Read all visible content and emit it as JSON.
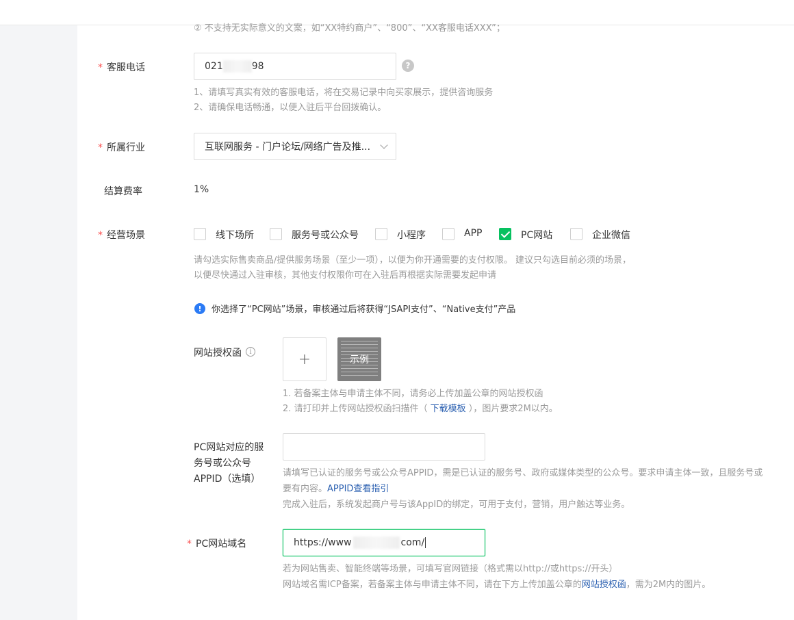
{
  "top_hint": "② 不支持无实际意义的文案，如“XX特约商户”、“800”、“XX客服电话XXX”；",
  "required_mark": "*",
  "service_phone": {
    "label": "客服电话",
    "value_prefix": "021",
    "value_suffix": "98",
    "help_icon": "?",
    "hints": [
      "1、请填写真实有效的客服电话，将在交易记录中向买家展示，提供咨询服务",
      "2、请确保电话畅通，以便入驻后平台回拨确认。"
    ]
  },
  "industry": {
    "label": "所属行业",
    "value": "互联网服务 - 门户论坛/网络广告及推..."
  },
  "fee": {
    "label": "结算费率",
    "value": "1%"
  },
  "scenes": {
    "label": "经营场景",
    "options": [
      {
        "label": "线下场所",
        "checked": false
      },
      {
        "label": "服务号或公众号",
        "checked": false
      },
      {
        "label": "小程序",
        "checked": false
      },
      {
        "label": "APP",
        "checked": false
      },
      {
        "label": "PC网站",
        "checked": true
      },
      {
        "label": "企业微信",
        "checked": false
      }
    ],
    "hints": [
      "请勾选实际售卖商品/提供服务场景（至少一项），以便为你开通需要的支付权限。 建议只勾选目前必须的场景，",
      "以便尽快通过入驻审核，其他支付权限你可在入驻后再根据实际需要发起申请"
    ],
    "notice": "你选择了“PC网站”场景，审核通过后将获得“JSAPI支付”、“Native支付”产品"
  },
  "auth_letter": {
    "label": "网站授权函",
    "upload_plus": "+",
    "sample_label": "示例",
    "hint1": "1. 若备案主体与申请主体不同，请务必上传加盖公章的网站授权函",
    "hint2_prefix": "2. 请打印并上传网站授权函扫描件（ ",
    "hint2_link": "下载模板",
    "hint2_suffix": " ），图片要求2M以内。"
  },
  "appid": {
    "label_lines": [
      "PC网站对应的服",
      "务号或公众号",
      "APPID（选填）"
    ],
    "value": "",
    "hint_line1": "请填写已认证的服务号或公众号APPID，需是已认证的服务号、政府或媒体类型的公众号。要求申请主体一致，且服务号或",
    "hint_line2_prefix": "要有内容。",
    "hint_line2_link": "APPID查看指引",
    "hint_line3": "完成入驻后，系统发起商户号与该AppID的绑定，可用于支付，营销，用户触达等业务。"
  },
  "domain": {
    "label": "PC网站域名",
    "value_prefix": "https://www",
    "value_suffix": "com/",
    "hint1": "若为网站售卖、智能终端等场景，可填写官网链接（格式需以http://或https://开头）",
    "hint2_prefix": "网站域名需ICP备案，若备案主体与申请主体不同，请在下方上传加盖公章的",
    "hint2_link": "网站授权函",
    "hint2_suffix": "，需为2M内的图片。"
  },
  "colors": {
    "accent": "#07c160",
    "link": "#2a5fb0",
    "required": "#fa5151",
    "info": "#2b7bf5"
  }
}
